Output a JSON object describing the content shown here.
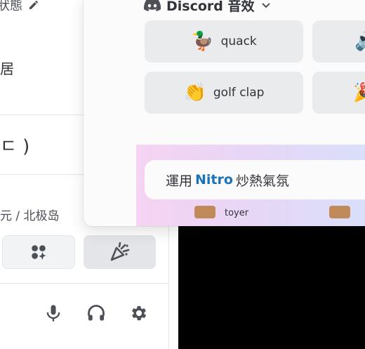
{
  "left_panel": {
    "status_fragment": "狀態",
    "fragment_1": "居",
    "fragment_2": "ㄷ )",
    "fragment_3": "元 / 北极岛"
  },
  "popup": {
    "header_title": "Discord 音效",
    "sounds": [
      {
        "label": "quack",
        "emoji": "🦆"
      },
      {
        "label": "golf clap",
        "emoji": "👏"
      },
      {
        "label": "",
        "emoji": "🔊"
      },
      {
        "label": "",
        "emoji": "🎉"
      }
    ],
    "nitro_card": {
      "prefix": "運用",
      "brand": "Nitro",
      "suffix": "炒熱氣氛"
    },
    "strip_fragment": "toyer"
  },
  "colors": {
    "accent": "#1a73b8",
    "text": "#313338",
    "panel": "#fbfbfc"
  },
  "icons": [
    "pencil-icon",
    "apps-icon",
    "soundboard-icon",
    "microphone-icon",
    "headphones-icon",
    "settings-icon",
    "discord-logo-icon",
    "chevron-down-icon"
  ]
}
